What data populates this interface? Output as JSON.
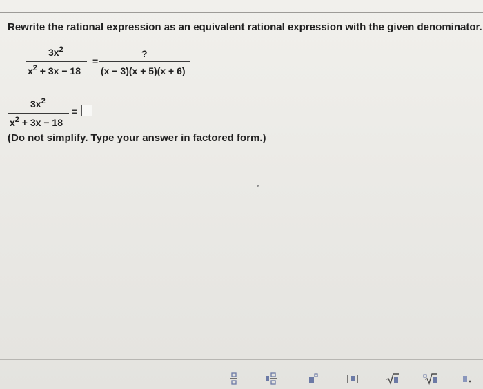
{
  "question": {
    "text": "Rewrite the rational expression as an equivalent rational expression with the given denominator."
  },
  "given": {
    "left_numerator_base": "3x",
    "left_numerator_exp": "2",
    "left_denominator_base": "x",
    "left_denominator_exp": "2",
    "left_denominator_rest": " + 3x − 18",
    "equals": "=",
    "right_numerator": "?",
    "right_denominator": "(x − 3)(x + 5)(x + 6)"
  },
  "answer": {
    "numerator_base": "3x",
    "numerator_exp": "2",
    "denominator_base": "x",
    "denominator_exp": "2",
    "denominator_rest": " + 3x − 18",
    "equals": "=",
    "box_value": ""
  },
  "instruction": {
    "text": "(Do not simplify. Type your answer in factored form.)"
  },
  "toolbar": {
    "icons": [
      "fraction-icon",
      "mixed-number-icon",
      "exponent-icon",
      "absolute-value-icon",
      "square-root-icon",
      "nth-root-icon",
      "decimal-icon"
    ]
  }
}
